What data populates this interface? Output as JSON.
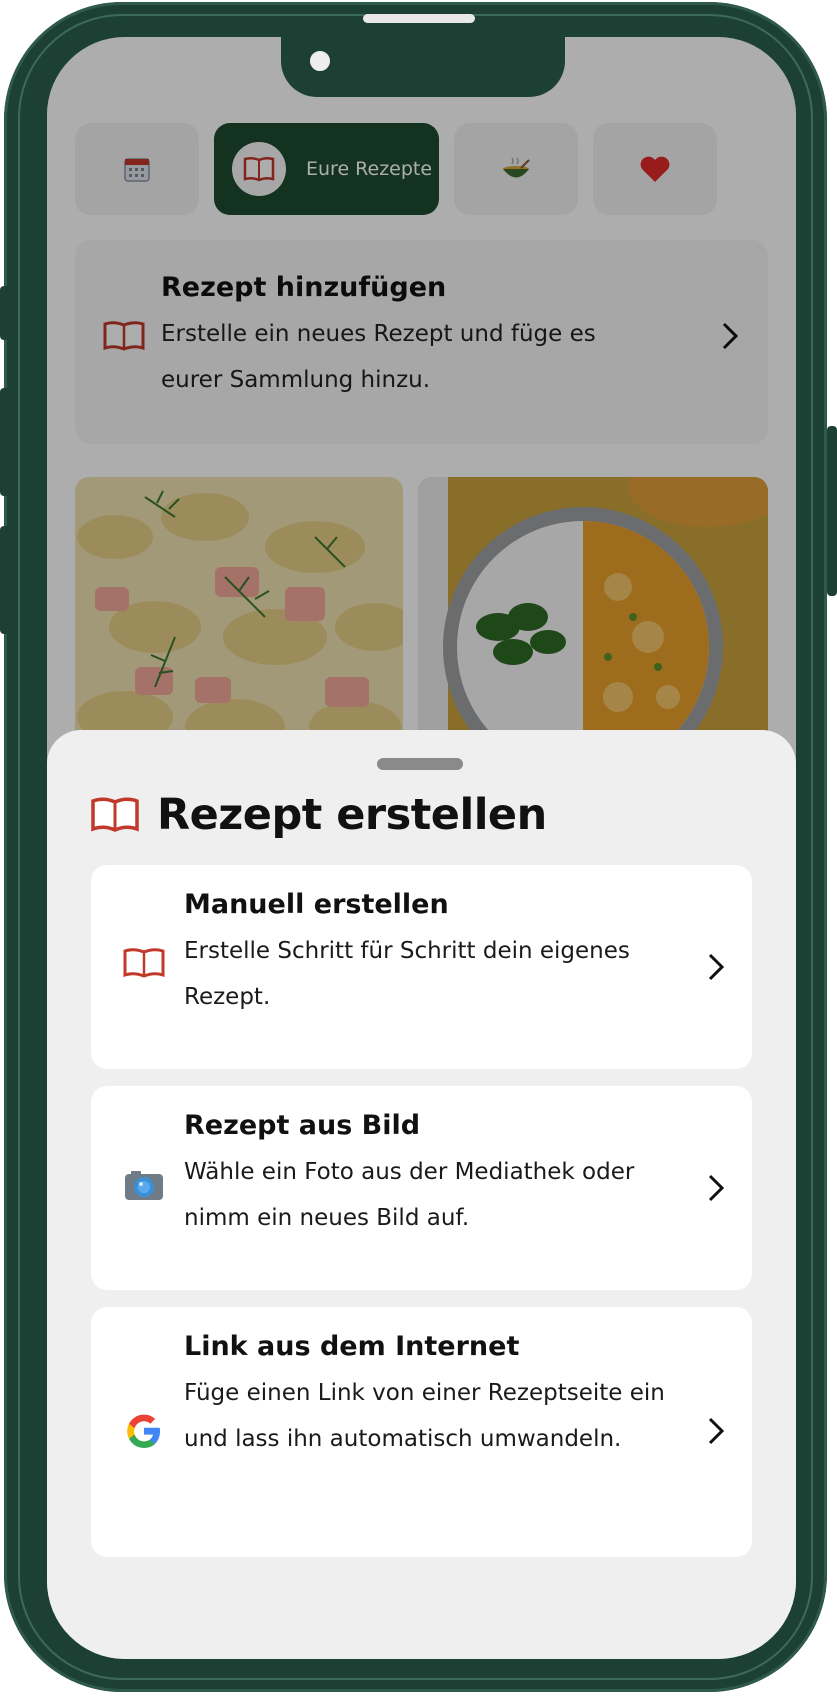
{
  "tabs": [
    {
      "icon": "calendar-icon",
      "label": ""
    },
    {
      "icon": "open-book-icon",
      "label": "Eure Rezepte"
    },
    {
      "icon": "soup-bowl-icon",
      "label": ""
    },
    {
      "icon": "heart-icon",
      "label": ""
    }
  ],
  "add_recipe": {
    "title": "Rezept hinzufügen",
    "description": "Erstelle ein neues Rezept und füge es eurer Sammlung hinzu.",
    "icon": "open-book-icon"
  },
  "recipe_photos": [
    {
      "description": "pasta-with-salmon-and-dill"
    },
    {
      "description": "curry-with-rice-and-parsley"
    }
  ],
  "sheet": {
    "title": "Rezept erstellen",
    "icon": "open-book-icon",
    "options": [
      {
        "title": "Manuell erstellen",
        "description": "Erstelle Schritt für Schritt dein eigenes Rezept.",
        "icon": "open-book-icon"
      },
      {
        "title": "Rezept aus Bild",
        "description": "Wähle ein Foto aus der Mediathek oder nimm ein neues Bild auf.",
        "icon": "camera-icon"
      },
      {
        "title": "Link aus dem Internet",
        "description": "Füge einen Link von einer Rezeptseite ein und lass ihn automatisch umwandeln.",
        "icon": "google-icon"
      }
    ]
  },
  "colors": {
    "frame": "#1c4033",
    "active_tab": "#1c4a2f",
    "sheet_bg": "#efefef",
    "overlay": "rgba(0,0,0,0.32)"
  }
}
